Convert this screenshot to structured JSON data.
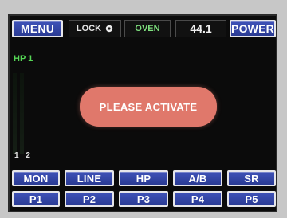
{
  "topbar": {
    "menu_label": "MENU",
    "lock_label": "LOCK",
    "lock_icon": "lock-icon",
    "oven_label": "OVEN",
    "readout": "44.1",
    "power_label": "POWER"
  },
  "meter": {
    "label": "HP 1",
    "channels": "1 2"
  },
  "alert": {
    "message": "PLEASE ACTIVATE"
  },
  "row1": [
    "MON",
    "LINE",
    "HP",
    "A/B",
    "SR"
  ],
  "row2": [
    "P1",
    "P2",
    "P3",
    "P4",
    "P5"
  ],
  "colors": {
    "button_blue": "#3448a8",
    "alert_red": "#e0786b",
    "oven_green": "#7ee07e",
    "label_green": "#55d655"
  }
}
